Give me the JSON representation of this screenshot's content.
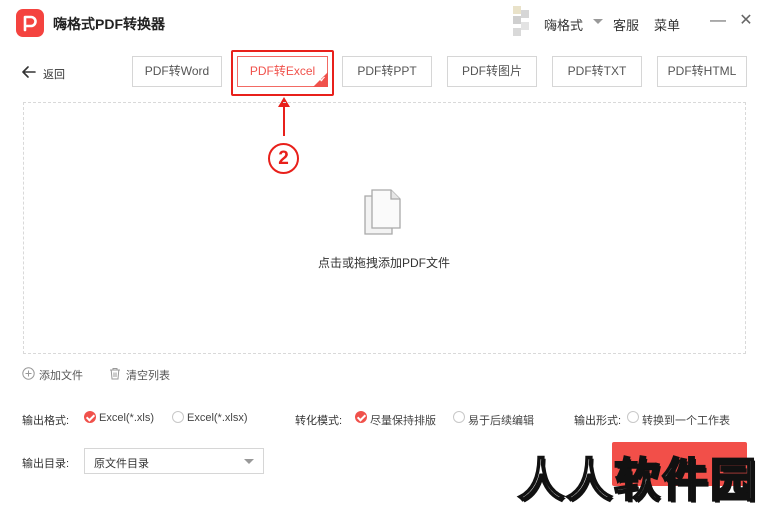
{
  "app": {
    "title": "嗨格式PDF转换器"
  },
  "topbar": {
    "user_name": "嗨格式",
    "service": "客服",
    "menu": "菜单",
    "minimize": "—",
    "close": "✕"
  },
  "nav": {
    "back": "返回"
  },
  "tabs": [
    {
      "label": "PDF转Word"
    },
    {
      "label": "PDF转Excel"
    },
    {
      "label": "PDF转PPT"
    },
    {
      "label": "PDF转图片"
    },
    {
      "label": "PDF转TXT"
    },
    {
      "label": "PDF转HTML"
    }
  ],
  "annotation": {
    "step": "2"
  },
  "dropzone": {
    "label": "点击或拖拽添加PDF文件"
  },
  "actions": {
    "add_file": "添加文件",
    "clear_list": "清空列表"
  },
  "options": {
    "format_label": "输出格式:",
    "format_a": "Excel(*.xls)",
    "format_b": "Excel(*.xlsx)",
    "mode_label": "转化模式:",
    "mode_a": "尽量保持排版",
    "mode_b": "易于后续编辑",
    "form_label": "输出形式:",
    "form_a": "转换到一个工作表"
  },
  "output": {
    "dir_label": "输出目录:",
    "dir_value": "原文件目录"
  },
  "watermark": "人人软件园",
  "colors": {
    "accent": "#f0514b",
    "annotation": "#e8201b"
  }
}
